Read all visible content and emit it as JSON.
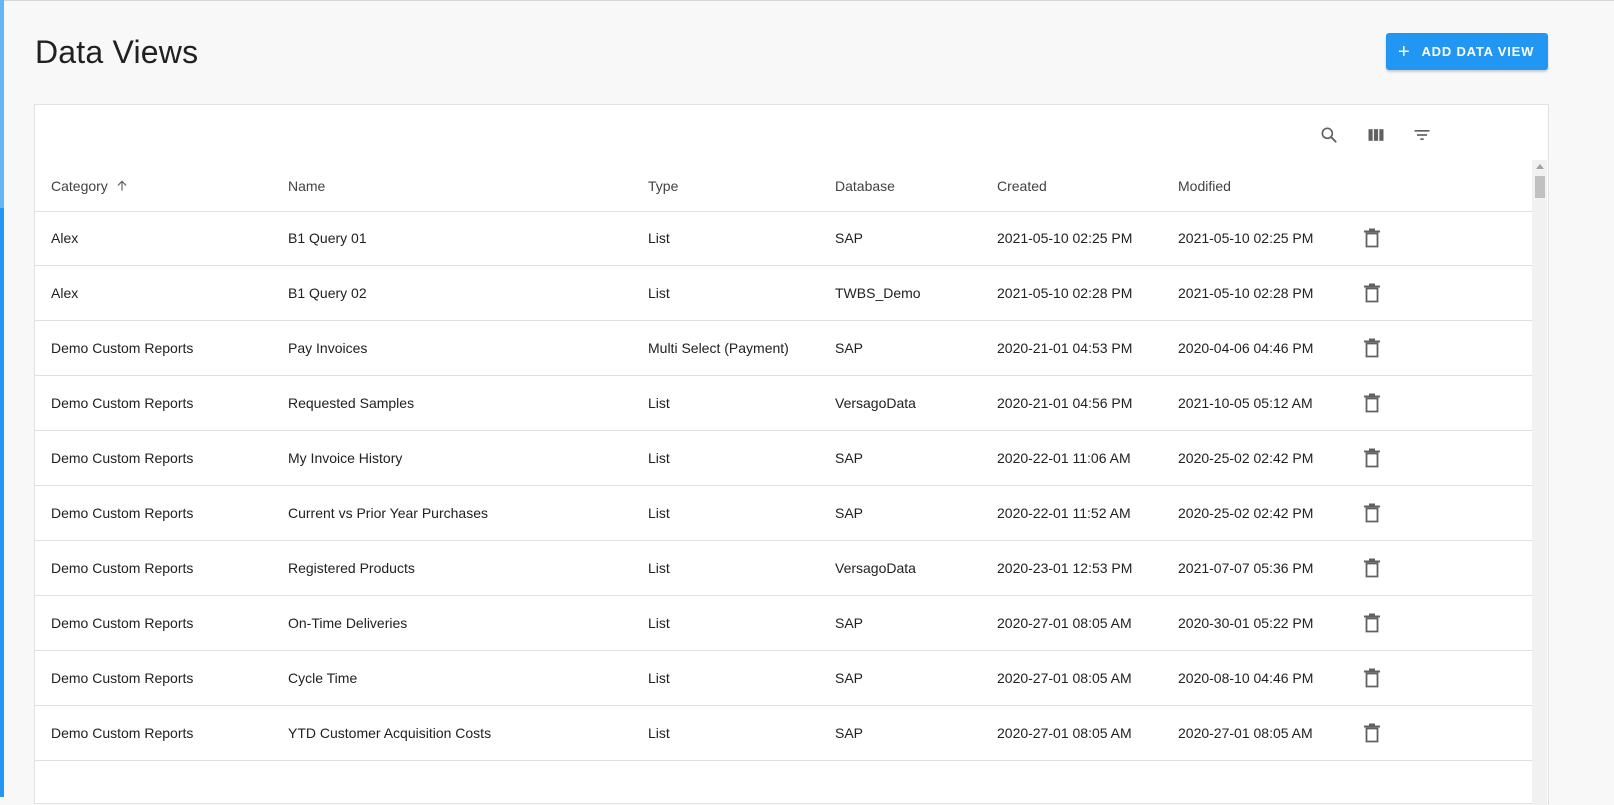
{
  "page": {
    "title": "Data Views",
    "add_button_label": "ADD DATA VIEW"
  },
  "toolbar": {
    "icons": [
      "search-icon",
      "view-column-icon",
      "filter-list-icon"
    ]
  },
  "table": {
    "columns": [
      "Category",
      "Name",
      "Type",
      "Database",
      "Created",
      "Modified"
    ],
    "sorted_column": "Category",
    "sort_direction": "ascending",
    "rows": [
      {
        "category": "Alex",
        "name": "B1 Query 01",
        "type": "List",
        "database": "SAP",
        "created": "2021-05-10 02:25 PM",
        "modified": "2021-05-10 02:25 PM"
      },
      {
        "category": "Alex",
        "name": "B1 Query 02",
        "type": "List",
        "database": "TWBS_Demo",
        "created": "2021-05-10 02:28 PM",
        "modified": "2021-05-10 02:28 PM"
      },
      {
        "category": "Demo Custom Reports",
        "name": "Pay Invoices",
        "type": "Multi Select (Payment)",
        "database": "SAP",
        "created": "2020-21-01 04:53 PM",
        "modified": "2020-04-06 04:46 PM"
      },
      {
        "category": "Demo Custom Reports",
        "name": "Requested Samples",
        "type": "List",
        "database": "VersagoData",
        "created": "2020-21-01 04:56 PM",
        "modified": "2021-10-05 05:12 AM"
      },
      {
        "category": "Demo Custom Reports",
        "name": "My Invoice History",
        "type": "List",
        "database": "SAP",
        "created": "2020-22-01 11:06 AM",
        "modified": "2020-25-02 02:42 PM"
      },
      {
        "category": "Demo Custom Reports",
        "name": "Current vs Prior Year Purchases",
        "type": "List",
        "database": "SAP",
        "created": "2020-22-01 11:52 AM",
        "modified": "2020-25-02 02:42 PM"
      },
      {
        "category": "Demo Custom Reports",
        "name": "Registered Products",
        "type": "List",
        "database": "VersagoData",
        "created": "2020-23-01 12:53 PM",
        "modified": "2021-07-07 05:36 PM"
      },
      {
        "category": "Demo Custom Reports",
        "name": "On-Time Deliveries",
        "type": "List",
        "database": "SAP",
        "created": "2020-27-01 08:05 AM",
        "modified": "2020-30-01 05:22 PM"
      },
      {
        "category": "Demo Custom Reports",
        "name": "Cycle Time",
        "type": "List",
        "database": "SAP",
        "created": "2020-27-01 08:05 AM",
        "modified": "2020-08-10 04:46 PM"
      },
      {
        "category": "Demo Custom Reports",
        "name": "YTD Customer Acquisition Costs",
        "type": "List",
        "database": "SAP",
        "created": "2020-27-01 08:05 AM",
        "modified": "2020-27-01 08:05 AM"
      }
    ]
  },
  "colors": {
    "accent": "#2196f3",
    "background": "#f8f8f8",
    "card": "#ffffff",
    "divider": "#e0e0e0",
    "icon": "#616161"
  }
}
